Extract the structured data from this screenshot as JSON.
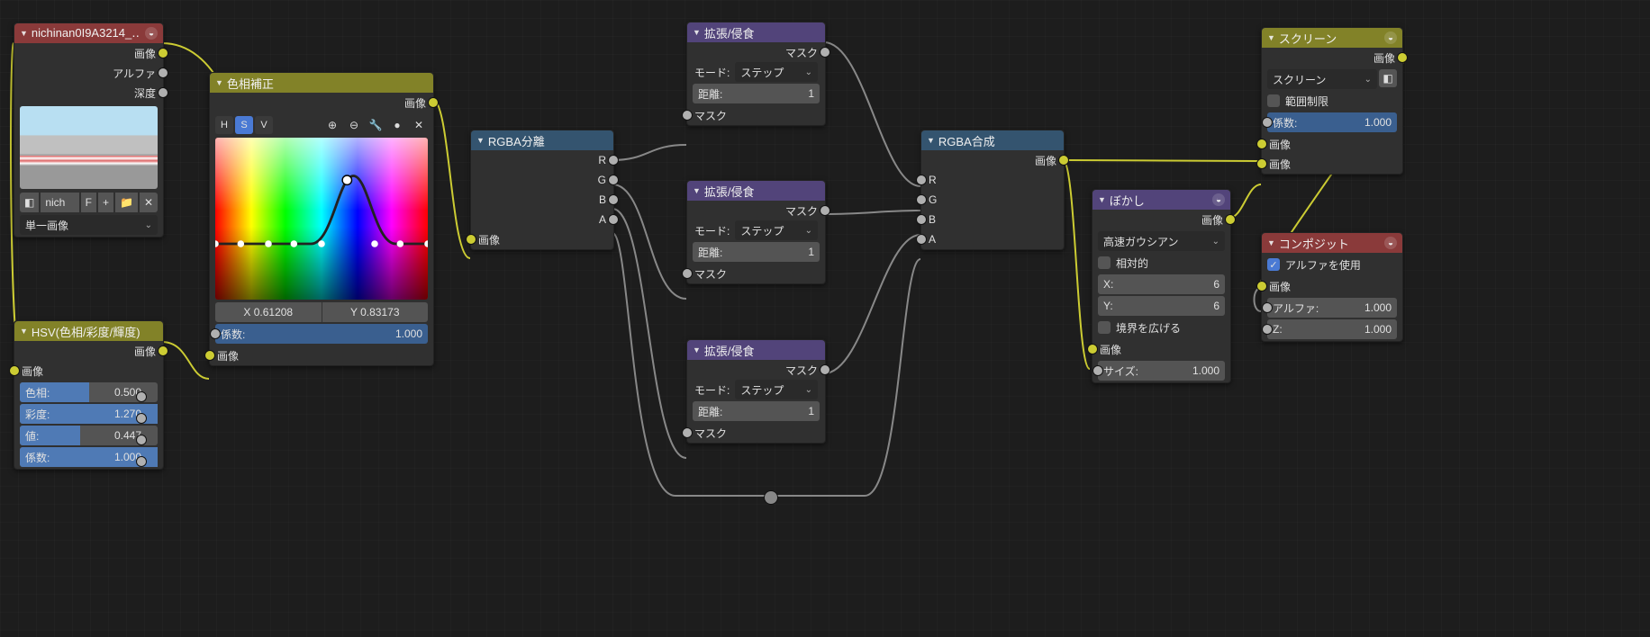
{
  "nodes": {
    "image": {
      "title": "nichinan0I9A3214_‥",
      "outputs": {
        "image": "画像",
        "alpha": "アルファ",
        "depth": "深度"
      },
      "picker": {
        "label": "nich",
        "f": "F",
        "plus": "+"
      },
      "source": "単一画像"
    },
    "hsv": {
      "title": "HSV(色相/彩度/輝度)",
      "outputs": {
        "image": "画像"
      },
      "inputs": {
        "image": "画像"
      },
      "fields": {
        "hue": {
          "label": "色相:",
          "value": "0.500",
          "prog": 50
        },
        "sat": {
          "label": "彩度:",
          "value": "1.270",
          "prog": 100
        },
        "val": {
          "label": "値:",
          "value": "0.447",
          "prog": 44
        },
        "fac": {
          "label": "係数:",
          "value": "1.000",
          "prog": 100
        }
      }
    },
    "huecorrect": {
      "title": "色相補正",
      "outputs": {
        "image": "画像"
      },
      "hsv": [
        "H",
        "S",
        "V"
      ],
      "xy": {
        "x": "X 0.61208",
        "y": "Y 0.83173"
      },
      "fac": {
        "label": "係数:",
        "value": "1.000"
      },
      "input_image": "画像"
    },
    "seprgba": {
      "title": "RGBA分離",
      "outputs": [
        "R",
        "G",
        "B",
        "A"
      ],
      "input": "画像"
    },
    "dilate": {
      "title": "拡張/侵食",
      "output": "マスク",
      "mode_label": "モード:",
      "mode_value": "ステップ",
      "distance_label": "距離:",
      "distance_value": "1",
      "input": "マスク"
    },
    "combrgba": {
      "title": "RGBA合成",
      "output": "画像",
      "inputs": [
        "R",
        "G",
        "B",
        "A"
      ]
    },
    "blur": {
      "title": "ぼかし",
      "output": "画像",
      "method": "高速ガウシアン",
      "relative": "相対的",
      "x": {
        "label": "X:",
        "value": "6"
      },
      "y": {
        "label": "Y:",
        "value": "6"
      },
      "extend": "境界を広げる",
      "input_image": "画像",
      "size": {
        "label": "サイズ:",
        "value": "1.000"
      }
    },
    "screen": {
      "title": "スクリーン",
      "output": "画像",
      "mode": "スクリーン",
      "clamp": "範囲制限",
      "fac": {
        "label": "係数:",
        "value": "1.000"
      },
      "inputs": [
        "画像",
        "画像"
      ]
    },
    "composite": {
      "title": "コンポジット",
      "use_alpha": "アルファを使用",
      "inputs": {
        "image": "画像",
        "alpha": {
          "label": "アルファ:",
          "value": "1.000"
        },
        "z": {
          "label": "Z:",
          "value": "1.000"
        }
      }
    }
  }
}
